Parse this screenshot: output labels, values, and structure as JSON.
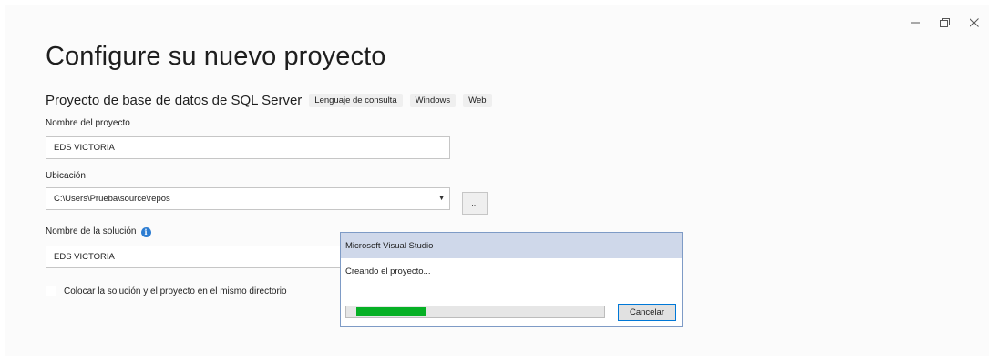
{
  "window": {
    "controls": [
      {
        "name": "minimize",
        "glyph": "minimize-icon"
      },
      {
        "name": "restore",
        "glyph": "restore-icon"
      },
      {
        "name": "close",
        "glyph": "close-icon"
      }
    ]
  },
  "page": {
    "title": "Configure su nuevo proyecto",
    "project_type": "Proyecto de base de datos de SQL Server",
    "tags": [
      "Lenguaje de consulta",
      "Windows",
      "Web"
    ]
  },
  "form": {
    "project_name_label": "Nombre del proyecto",
    "project_name_value": "EDS VICTORIA",
    "location_label": "Ubicación",
    "location_value": "C:\\Users\\Prueba\\source\\repos",
    "browse_label": "...",
    "solution_name_label": "Nombre de la solución",
    "solution_name_value": "EDS VICTORIA",
    "same_dir_label": "Colocar la solución y el proyecto en el mismo directorio",
    "same_dir_checked": false
  },
  "dialog": {
    "title": "Microsoft Visual Studio",
    "message": "Creando el proyecto...",
    "progress": 0.27,
    "cancel_label": "Cancelar"
  },
  "colors": {
    "progress_fill": "#06b025",
    "dialog_titlebar": "#cfd8ea",
    "info_icon": "#2d7dd2"
  }
}
